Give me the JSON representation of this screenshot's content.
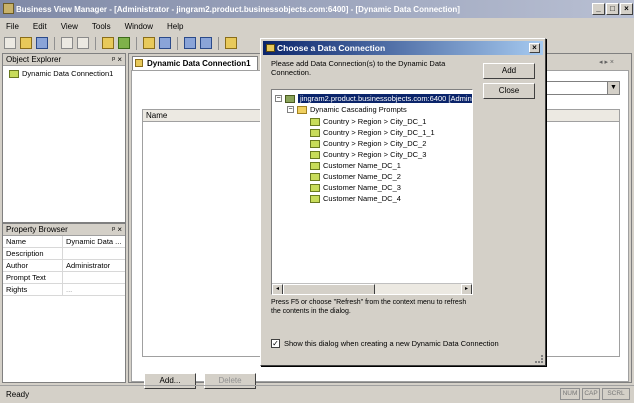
{
  "window": {
    "title": "Business View Manager - [Administrator - jingram2.product.businessobjects.com:6400] - [Dynamic Data Connection]"
  },
  "window_controls": {
    "minimize": "_",
    "restore": "□",
    "close": "×"
  },
  "menu": [
    "File",
    "Edit",
    "View",
    "Tools",
    "Window",
    "Help"
  ],
  "object_explorer": {
    "title": "Object Explorer",
    "pin": "ᵖ ×",
    "items": [
      "Dynamic Data Connection1"
    ]
  },
  "property_browser": {
    "title": "Property Browser",
    "pin": "ᵖ ×",
    "rows": [
      {
        "key": "Name",
        "value": "Dynamic Data ..."
      },
      {
        "key": "Description",
        "value": ""
      },
      {
        "key": "Author",
        "value": "Administrator"
      },
      {
        "key": "Prompt Text",
        "value": ""
      },
      {
        "key": "Rights",
        "value": "..."
      }
    ]
  },
  "document": {
    "tab": "Dynamic Data Connection1",
    "tab_nav": "◂ ▸ ×",
    "grid_header": "Name",
    "add_label": "Add...",
    "delete_label": "Delete"
  },
  "status": {
    "text": "Ready",
    "cells": [
      "NUM",
      "CAP",
      "SCRL"
    ]
  },
  "dialog": {
    "title": "Choose a Data Connection",
    "instructions": "Please add Data Connection(s) to the Dynamic Data Connection.",
    "add_label": "Add",
    "close_label": "Close",
    "tree": {
      "server": "jingram2.product.businessobjects.com:6400 [Admin",
      "folder": "Dynamic Cascading Prompts",
      "connections": [
        "Country > Region > City_DC_1",
        "Country > Region > City_DC_1_1",
        "Country > Region > City_DC_2",
        "Country > Region > City_DC_3",
        "Customer Name_DC_1",
        "Customer Name_DC_2",
        "Customer Name_DC_3",
        "Customer Name_DC_4"
      ]
    },
    "hint": "Press F5 or choose \"Refresh\" from the context menu to refresh the contents in the dialog.",
    "checkbox_label": "Show this dialog when creating a new Dynamic Data Connection",
    "checkbox_checked": true
  },
  "colors": {
    "dialog_title": "#0a246a",
    "selection": "#0a246a"
  }
}
